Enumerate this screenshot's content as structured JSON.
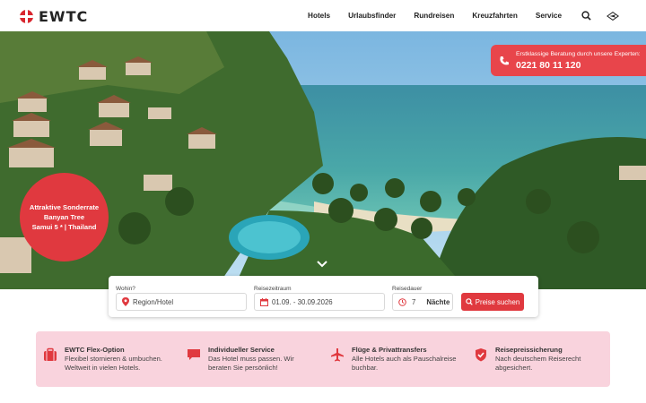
{
  "header": {
    "logo_text": "EWTC",
    "nav": [
      "Hotels",
      "Urlaubsfinder",
      "Rundreisen",
      "Kreuzfahrten",
      "Service"
    ],
    "icons": [
      "search-icon",
      "airplane-stamp-icon"
    ]
  },
  "hero": {
    "expert_caption": "Erstklassige Beratung durch unsere Experten:",
    "expert_phone": "0221 80 11 120",
    "badge_lines": [
      "Attraktive Sonderrate",
      "Banyan Tree",
      "Samui 5 * | Thailand"
    ]
  },
  "search": {
    "region_label": "Wohin?",
    "region_placeholder": "Region/Hotel",
    "period_label": "Reisezeitraum",
    "period_value": "01.09. - 30.09.2026",
    "duration_label": "Reisedauer",
    "duration_value": "7",
    "duration_unit": "Nächte",
    "button_label": "Preise suchen"
  },
  "features": [
    {
      "icon": "suitcase-icon",
      "title": "EWTC Flex-Option",
      "lines": [
        "Flexibel stornieren & umbuchen.",
        "Weltweit in vielen Hotels."
      ]
    },
    {
      "icon": "chat-bubble-icon",
      "title": "Individueller Service",
      "lines": [
        "Das Hotel muss passen. Wir",
        "beraten Sie persönlich!"
      ]
    },
    {
      "icon": "airplane-icon",
      "title": "Flüge & Privattransfers",
      "lines": [
        "Alle Hotels auch als Pauschalreise",
        "buchbar."
      ]
    },
    {
      "icon": "shield-check-icon",
      "title": "Reisepreissicherung",
      "lines": [
        "Nach deutschem Reiserecht",
        "abgesichert."
      ]
    }
  ],
  "colors": {
    "accent": "#e0393f",
    "feature_bg": "#f9d3dd"
  }
}
